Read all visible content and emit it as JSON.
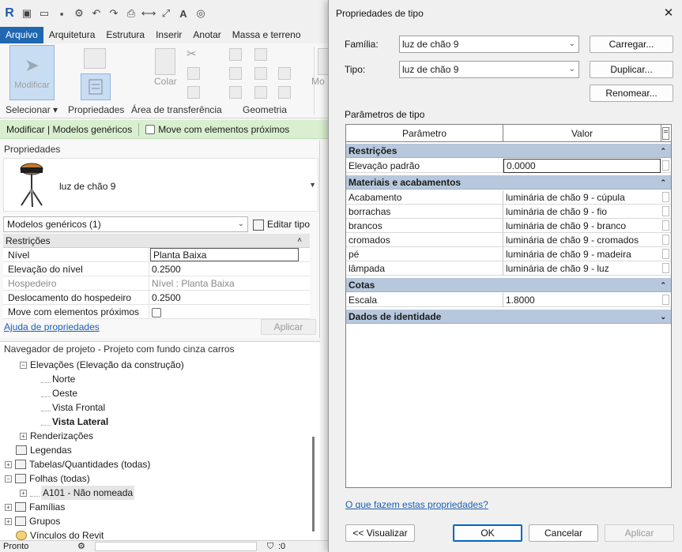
{
  "revit": {
    "menu": [
      "Arquivo",
      "Arquitetura",
      "Estrutura",
      "Inserir",
      "Anotar",
      "Massa e terreno"
    ],
    "ribbon": {
      "modify_label": "Modificar",
      "color_label": "Colar",
      "mo_label": "Mo",
      "groups": [
        "Selecionar",
        "Propriedades",
        "Área de transferência",
        "Geometria"
      ]
    },
    "context": {
      "title": "Modificar | Modelos genéricos",
      "move_with": "Move com elementos próximos"
    },
    "properties": {
      "title": "Propriedades",
      "type_name": "luz de chão 9",
      "filter": "Modelos genéricos (1)",
      "edit_type": "Editar tipo",
      "section": "Restrições",
      "rows": [
        {
          "key": "Nível",
          "value": "Planta Baixa"
        },
        {
          "key": "Elevação do nível",
          "value": "0.2500"
        },
        {
          "key": "Hospedeiro",
          "value": "Nível : Planta Baixa"
        },
        {
          "key": "Deslocamento do hospedeiro",
          "value": "0.2500"
        },
        {
          "key": "Move com elementos próximos",
          "value": ""
        }
      ],
      "help": "Ajuda de propriedades",
      "apply": "Aplicar"
    },
    "browser": {
      "title": "Navegador de projeto - Projeto com fundo cinza carros",
      "items": [
        "Elevações (Elevação da construção)",
        "Norte",
        "Oeste",
        "Vista Frontal",
        "Vista Lateral",
        "Renderizações",
        "Legendas",
        "Tabelas/Quantidades (todas)",
        "Folhas (todas)",
        "A101 - Não nomeada",
        "Famílias",
        "Grupos",
        "Vínculos do Revit"
      ]
    },
    "status": {
      "text": "Pronto",
      "count": ":0"
    }
  },
  "dialog": {
    "title": "Propriedades de tipo",
    "family_label": "Família:",
    "family_value": "luz de chão 9",
    "type_label": "Tipo:",
    "type_value": "luz de chão 9",
    "load_btn": "Carregar...",
    "duplicate_btn": "Duplicar...",
    "rename_btn": "Renomear...",
    "params_label": "Parâmetros de tipo",
    "col_param": "Parâmetro",
    "col_value": "Valor",
    "col_extra": "=",
    "groups": {
      "constraints": "Restrições",
      "materials": "Materiais e acabamentos",
      "dimensions": "Cotas",
      "identity": "Dados de identidade"
    },
    "constraints_rows": [
      {
        "key": "Elevação padrão",
        "value": "0.0000"
      }
    ],
    "material_rows": [
      {
        "key": "Acabamento",
        "value": "luminária de chão 9 - cúpula"
      },
      {
        "key": "borrachas",
        "value": "luminária de chão 9 - fio"
      },
      {
        "key": "brancos",
        "value": "luminária de chão 9 - branco"
      },
      {
        "key": "cromados",
        "value": "luminária de chão 9 - cromados"
      },
      {
        "key": "pé",
        "value": "luminária de chão 9 - madeira"
      },
      {
        "key": "lâmpada",
        "value": "luminária de chão 9 - luz"
      }
    ],
    "dimension_rows": [
      {
        "key": "Escala",
        "value": "1.8000"
      }
    ],
    "help_link": "O que fazem estas propriedades?",
    "preview_btn": "<< Visualizar",
    "ok_btn": "OK",
    "cancel_btn": "Cancelar",
    "apply_btn": "Aplicar"
  },
  "colors": {
    "accent": "#1f67b1",
    "group_header": "#b7c8dc",
    "context_bar": "#d9efcf",
    "link": "#1a5fb4"
  }
}
